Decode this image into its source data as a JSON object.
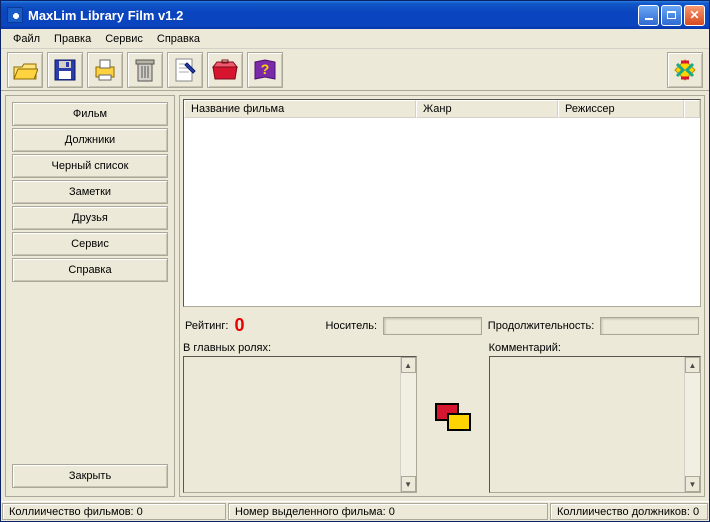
{
  "title": "MaxLim Library Film v1.2",
  "menu": [
    "Файл",
    "Правка",
    "Сервис",
    "Справка"
  ],
  "toolbar_icons": [
    "open",
    "save",
    "print",
    "delete",
    "edit",
    "box",
    "help",
    "logo"
  ],
  "sidebar": {
    "items": [
      "Фильм",
      "Должники",
      "Черный список",
      "Заметки",
      "Друзья",
      "Сервис",
      "Справка"
    ],
    "close_label": "Закрыть"
  },
  "grid": {
    "columns": [
      "Название фильма",
      "Жанр",
      "Режиссер"
    ]
  },
  "info": {
    "rating_label": "Рейтинг:",
    "rating_value": "0",
    "media_label": "Носитель:",
    "media_value": "",
    "duration_label": "Продолжительность:",
    "duration_value": ""
  },
  "bottom": {
    "cast_label": "В главных ролях:",
    "comment_label": "Комментарий:"
  },
  "status": {
    "films": "Коллиичество фильмов: 0",
    "selected": "Номер выделенного фильма: 0",
    "debtors": "Коллиичество  должников: 0"
  }
}
